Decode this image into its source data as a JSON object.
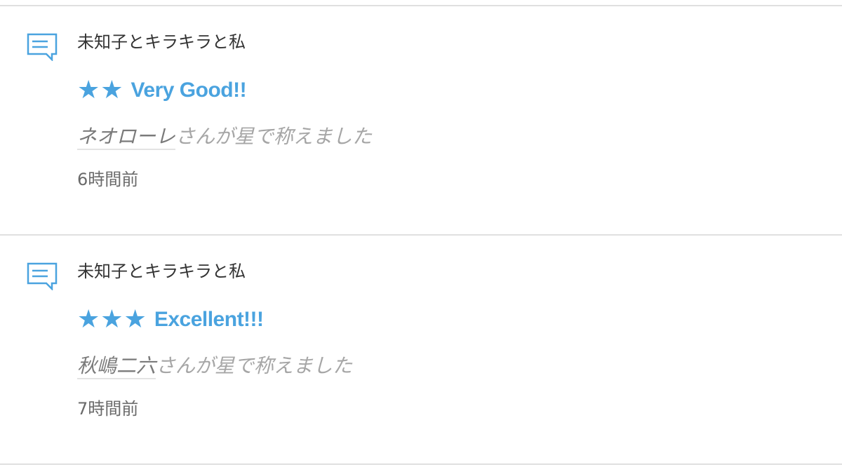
{
  "colors": {
    "accent": "#4aa3df",
    "title_text": "#333333",
    "muted_text": "#a6a6a6",
    "username_text": "#7a7a7a",
    "time_text": "#6a6a6a",
    "divider": "#e0e0e0"
  },
  "icon": "comment-bubble-icon",
  "notifications": [
    {
      "work_title": "未知子とキラキラと私",
      "stars": "★★",
      "star_count": 2,
      "rating_label": "Very Good!!",
      "user": "ネオローレ",
      "praise_suffix": "さんが星で称えました",
      "time": "6時間前"
    },
    {
      "work_title": "未知子とキラキラと私",
      "stars": "★★★",
      "star_count": 3,
      "rating_label": "Excellent!!!",
      "user": "秋嶋二六",
      "praise_suffix": "さんが星で称えました",
      "time": "7時間前"
    }
  ]
}
